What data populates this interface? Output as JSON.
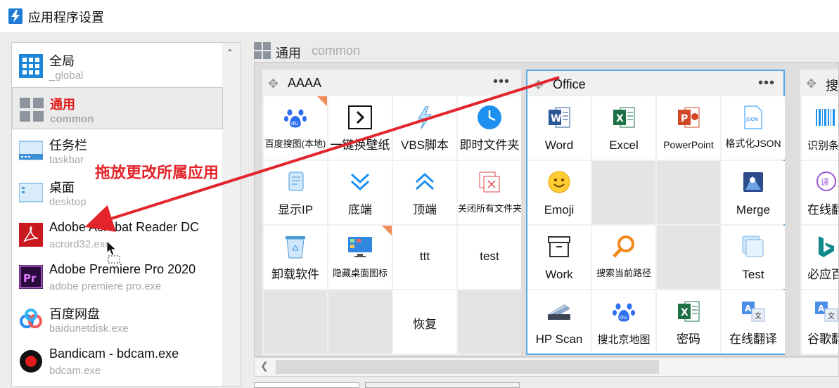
{
  "window": {
    "title": "应用程序设置"
  },
  "app_list": [
    {
      "title": "全局",
      "subtitle": "_global",
      "icon": "grid-icon"
    },
    {
      "title": "通用",
      "subtitle": "common",
      "icon": "tiles-icon",
      "selected": true
    },
    {
      "title": "任务栏",
      "subtitle": "taskbar",
      "icon": "taskbar-icon"
    },
    {
      "title": "桌面",
      "subtitle": "desktop",
      "icon": "desktop-icon"
    },
    {
      "title": "Adobe Acrobat Reader DC",
      "subtitle": "acrord32.exe",
      "icon": "acrobat-icon"
    },
    {
      "title": "Adobe Premiere Pro 2020",
      "subtitle": "adobe premiere pro.exe",
      "icon": "premiere-icon"
    },
    {
      "title": "百度网盘",
      "subtitle": "baidunetdisk.exe",
      "icon": "baidunetdisk-icon"
    },
    {
      "title": "Bandicam - bdcam.exe",
      "subtitle": "bdcam.exe",
      "icon": "bandicam-icon"
    }
  ],
  "header": {
    "title": "通用",
    "subtitle": "common"
  },
  "annotation": "拖放更改所属应用",
  "groups": [
    {
      "title": "AAAA",
      "menu": "•••",
      "tiles": [
        {
          "label": "百度搜图(本地)",
          "icon": "baidu-paw-icon",
          "small": true,
          "badge": true
        },
        {
          "label": "一键换壁纸",
          "icon": "terminal-arrow-icon"
        },
        {
          "label": "VBS脚本",
          "icon": "lightning-icon"
        },
        {
          "label": "即时文件夹",
          "icon": "clock-icon"
        },
        {
          "label": "显示IP",
          "icon": "scroll-icon"
        },
        {
          "label": "底端",
          "icon": "double-chevron-down-icon"
        },
        {
          "label": "顶端",
          "icon": "double-chevron-up-icon"
        },
        {
          "label": "关闭所有文件夹",
          "icon": "close-windows-icon",
          "small": true
        },
        {
          "label": "卸载软件",
          "icon": "recycle-bin-icon"
        },
        {
          "label": "隐藏桌面图标",
          "icon": "monitor-icon",
          "small": true,
          "badge": true
        },
        {
          "label": "ttt",
          "icon": ""
        },
        {
          "label": "test",
          "icon": ""
        },
        {
          "label": "",
          "empty": true
        },
        {
          "label": "",
          "empty": true
        },
        {
          "label": "恢复",
          "icon": ""
        },
        {
          "label": "",
          "empty": true
        }
      ]
    },
    {
      "title": "Office",
      "menu": "•••",
      "tiles": [
        {
          "label": "Word",
          "icon": "word-icon"
        },
        {
          "label": "Excel",
          "icon": "excel-icon"
        },
        {
          "label": "PowerPoint",
          "icon": "powerpoint-icon",
          "small_font": true
        },
        {
          "label": "格式化JSON",
          "icon": "json-file-icon",
          "small_font": true
        },
        {
          "label": "Emoji",
          "icon": "smiley-icon"
        },
        {
          "label": "",
          "empty": true
        },
        {
          "label": "",
          "empty": true
        },
        {
          "label": "Merge",
          "icon": "merge-icon"
        },
        {
          "label": "Work",
          "icon": "archive-box-icon"
        },
        {
          "label": "搜索当前路径",
          "icon": "magnifier-icon",
          "small": true
        },
        {
          "label": "",
          "empty": true
        },
        {
          "label": "Test",
          "icon": "window-stack-icon"
        },
        {
          "label": "HP Scan",
          "icon": "scanner-icon"
        },
        {
          "label": "搜北京地图",
          "icon": "baidu-paw-icon",
          "small_font": true
        },
        {
          "label": "密码",
          "icon": "excel-icon"
        },
        {
          "label": "在线翻译",
          "icon": "translate-icon"
        }
      ]
    },
    {
      "title": "搜",
      "tiles": [
        {
          "label": "识别条",
          "icon": "barcode-icon",
          "small_font": true
        },
        {
          "label": "在线翻",
          "icon": "translate-bubble-icon"
        },
        {
          "label": "必应百",
          "icon": "bing-icon"
        },
        {
          "label": "谷歌翻",
          "icon": "translate-icon"
        }
      ]
    }
  ],
  "colors": {
    "accent_red": "#e3242b",
    "selection_blue": "#5aa7e3",
    "badge_orange": "#f08b5a"
  }
}
